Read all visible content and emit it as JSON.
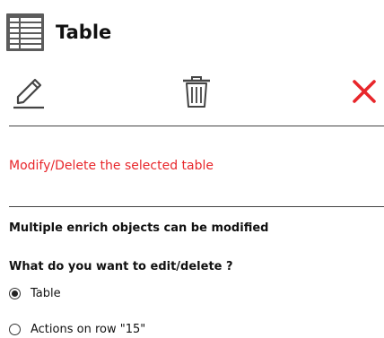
{
  "header": {
    "title": "Table",
    "icon": "table-icon"
  },
  "toolbar": {
    "edit_icon": "pencil-icon",
    "delete_icon": "trash-icon",
    "close_icon": "close-icon",
    "close_color": "#e8262b"
  },
  "message": {
    "text": "Modify/Delete the selected table",
    "color": "#e8262b"
  },
  "info": {
    "multiple_text": "Multiple enrich objects can be modified",
    "question": "What do you want to edit/delete ?"
  },
  "options": [
    {
      "label": "Table",
      "selected": true
    },
    {
      "label": "Actions on row \"15\"",
      "selected": false
    }
  ]
}
